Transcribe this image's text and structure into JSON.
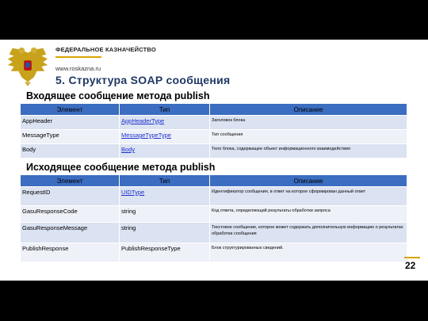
{
  "header": {
    "org": "ФЕДЕРАЛЬНОЕ КАЗНАЧЕЙСТВО",
    "site": "www.roskazna.ru",
    "title": "5. Структура SOAP сообщения"
  },
  "incoming": {
    "heading": "Входящее сообщение метода publish",
    "columns": [
      "Элемент",
      "Тип",
      "Описание"
    ],
    "rows": [
      {
        "element": "AppHeader",
        "type": "AppHeaderType",
        "desc": "Заголовок блока"
      },
      {
        "element": "MessageType",
        "type": "MessageTypeType",
        "desc": "Тип сообщения"
      },
      {
        "element": "Body",
        "type": "Body",
        "desc": "Тело блока, содержащее объект информационного взаимодействия"
      }
    ]
  },
  "outgoing": {
    "heading": "Исходящее сообщение метода publish",
    "columns": [
      "Элемент",
      "Тип",
      "Описание"
    ],
    "rows": [
      {
        "element": "RequestID",
        "type": "UIDType",
        "desc": "Идентификатор сообщения, в ответ на которое сформирован данный ответ"
      },
      {
        "element": "GasuResponseCode",
        "type": "string",
        "desc": "Код ответа, определяющий результаты обработки запроса"
      },
      {
        "element": "GasuResponseMessage",
        "type": "string",
        "desc": "Текстовое сообщение, которое может содержать дополнительную информацию о результатах обработки сообщения"
      },
      {
        "element": "PublishResponse",
        "type": "PublishResponseType",
        "desc": "Блок структурированных сведений."
      }
    ]
  },
  "page_number": "22",
  "colors": {
    "header_bg": "#3b6dc0",
    "row_bg": "#dbe2f1",
    "title": "#1f3864",
    "accent": "#d9a400"
  }
}
